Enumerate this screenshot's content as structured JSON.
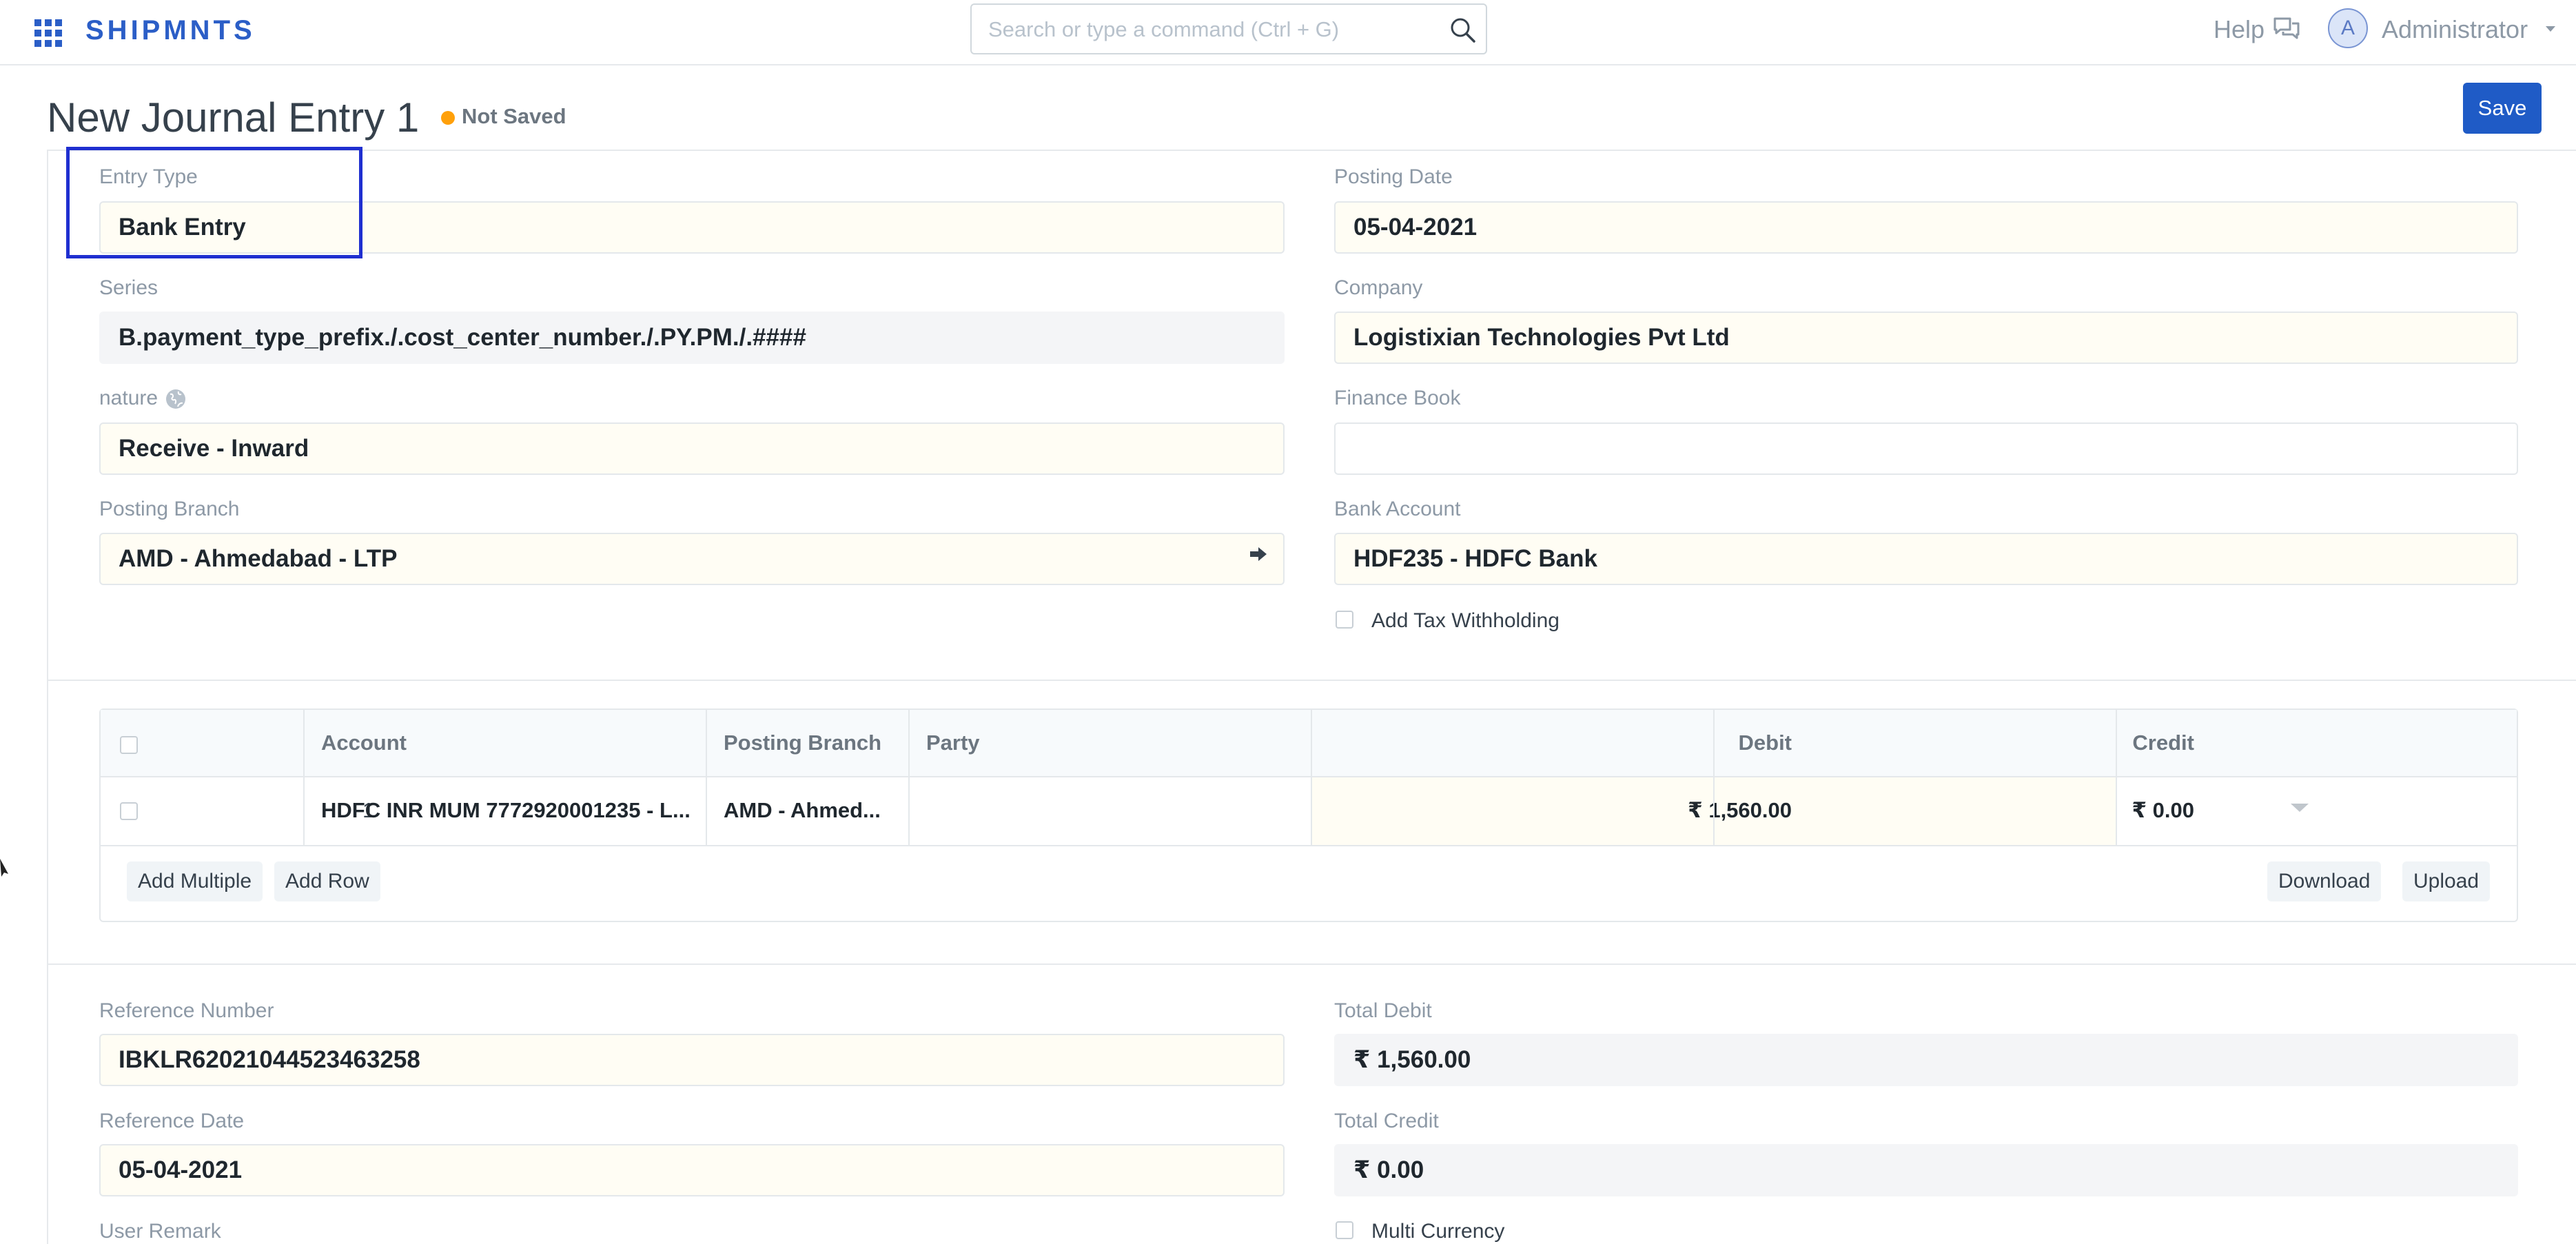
{
  "navbar": {
    "brand": "SHIPMNTS",
    "search_placeholder": "Search or type a command (Ctrl + G)",
    "help_label": "Help",
    "avatar_initial": "A",
    "user_name": "Administrator"
  },
  "page": {
    "title": "New Journal Entry 1",
    "status": "Not Saved",
    "save_label": "Save"
  },
  "form": {
    "entry_type": {
      "label": "Entry Type",
      "value": "Bank Entry"
    },
    "posting_date": {
      "label": "Posting Date",
      "value": "05-04-2021"
    },
    "series": {
      "label": "Series",
      "value": "B.payment_type_prefix./.cost_center_number./.PY.PM./.####"
    },
    "company": {
      "label": "Company",
      "value": "Logistixian Technologies Pvt Ltd"
    },
    "nature": {
      "label": "nature",
      "value": "Receive - Inward"
    },
    "finance_book": {
      "label": "Finance Book",
      "value": ""
    },
    "posting_branch": {
      "label": "Posting Branch",
      "value": "AMD - Ahmedabad - LTP"
    },
    "bank_account": {
      "label": "Bank Account",
      "value": "HDF235 - HDFC Bank"
    },
    "add_tax_withholding": {
      "label": "Add Tax Withholding",
      "checked": false
    }
  },
  "accounts_table": {
    "columns": [
      "Account",
      "Posting Branch",
      "Party",
      "Debit",
      "Credit"
    ],
    "rows": [
      {
        "idx": "1",
        "account": "HDFC INR MUM 7772920001235 - L...",
        "posting_branch": "AMD - Ahmed...",
        "party": "",
        "debit": "₹ 1,560.00",
        "credit": "₹ 0.00"
      }
    ],
    "buttons": {
      "add_multiple": "Add Multiple",
      "add_row": "Add Row",
      "download": "Download",
      "upload": "Upload"
    }
  },
  "reference": {
    "reference_number": {
      "label": "Reference Number",
      "value": "IBKLR62021044523463258"
    },
    "total_debit": {
      "label": "Total Debit",
      "value": "₹ 1,560.00"
    },
    "reference_date": {
      "label": "Reference Date",
      "value": "05-04-2021"
    },
    "total_credit": {
      "label": "Total Credit",
      "value": "₹ 0.00"
    },
    "user_remark": {
      "label": "User Remark"
    },
    "multi_currency": {
      "label": "Multi Currency",
      "checked": false
    }
  },
  "colors": {
    "primary": "#1f5bc6",
    "brand": "#2b5ec7",
    "warning": "#ffa00a",
    "highlight_border": "#1f2fd0"
  }
}
